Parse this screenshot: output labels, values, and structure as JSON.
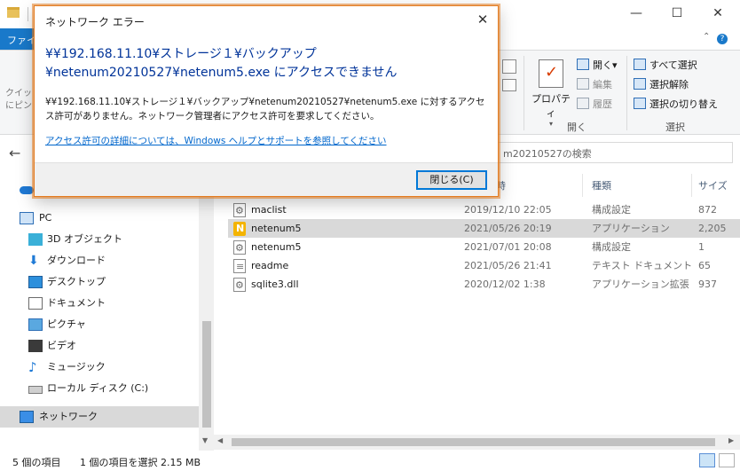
{
  "explorer": {
    "file_tab": "ファイ",
    "quick_access": [
      "クイッ",
      "にピン"
    ],
    "window_controls": {
      "minimize": "—",
      "maximize": "☐",
      "close": "✕"
    },
    "ribbon": {
      "properties": "プロパティ",
      "open": "開く",
      "open_arrow": "▾",
      "edit": "編集",
      "history": "履歴",
      "group_open": "開く",
      "select_all": "すべて選択",
      "select_none": "選択解除",
      "invert_selection": "選択の切り替え",
      "group_select": "選択"
    },
    "search_placeholder": "m20210527の検索",
    "nav": [
      {
        "label": "",
        "icon": "cloud-icon"
      },
      {
        "label": "PC",
        "icon": "pc-icon"
      },
      {
        "label": "3D オブジェクト",
        "icon": "3d-objects-icon"
      },
      {
        "label": "ダウンロード",
        "icon": "download-icon"
      },
      {
        "label": "デスクトップ",
        "icon": "desktop-icon"
      },
      {
        "label": "ドキュメント",
        "icon": "documents-icon"
      },
      {
        "label": "ピクチャ",
        "icon": "pictures-icon"
      },
      {
        "label": "ビデオ",
        "icon": "video-icon"
      },
      {
        "label": "ミュージック",
        "icon": "music-icon"
      },
      {
        "label": "ローカル ディスク (C:)",
        "icon": "local-disk-icon"
      },
      {
        "label": "ネットワーク",
        "icon": "network-icon"
      }
    ],
    "columns": {
      "date": "時",
      "type": "種類",
      "size": "サイズ"
    },
    "files": [
      {
        "name": "maclist",
        "date": "2019/12/10 22:05",
        "type": "構成設定",
        "size": "872",
        "icon": "gear"
      },
      {
        "name": "netenum5",
        "date": "2021/05/26 20:19",
        "type": "アプリケーション",
        "size": "2,205",
        "icon": "app"
      },
      {
        "name": "netenum5",
        "date": "2021/07/01 20:08",
        "type": "構成設定",
        "size": "1",
        "icon": "gear"
      },
      {
        "name": "readme",
        "date": "2021/05/26 21:41",
        "type": "テキスト ドキュメント",
        "size": "65",
        "icon": "doc"
      },
      {
        "name": "sqlite3.dll",
        "date": "2020/12/02 1:38",
        "type": "アプリケーション拡張",
        "size": "937",
        "icon": "gear"
      }
    ],
    "status": {
      "item_count": "5 個の項目",
      "selected": "1 個の項目を選択  2.15 MB"
    }
  },
  "dialog": {
    "title": "ネットワーク エラー",
    "close_glyph": "✕",
    "heading_line1": "¥¥192.168.11.10¥ストレージ１¥バックアップ",
    "heading_line2": "¥netenum20210527¥netenum5.exe にアクセスできません",
    "body": "¥¥192.168.11.10¥ストレージ１¥バックアップ¥netenum20210527¥netenum5.exe に対するアクセス許可がありません。ネットワーク管理者にアクセス許可を要求してください。",
    "link": "アクセス許可の詳細については、Windows ヘルプとサポートを参照してください",
    "button": "閉じる(C)"
  },
  "colors": {
    "accent": "#1979ca",
    "dialog_border": "#e47b1f",
    "link": "#0066cc"
  }
}
